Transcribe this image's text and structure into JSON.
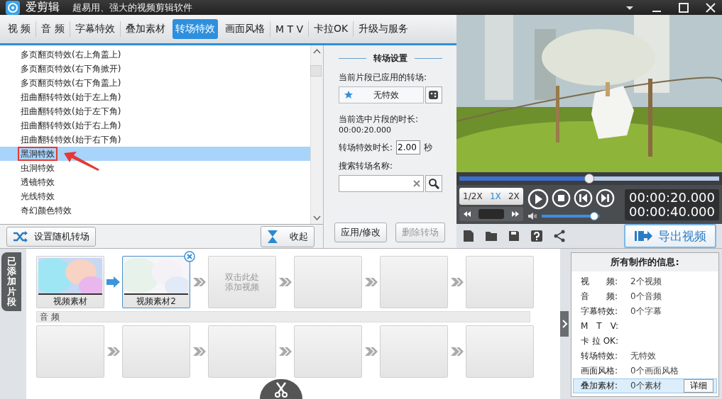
{
  "app": {
    "name": "爱剪辑",
    "tagline": "超易用、强大的视频剪辑软件"
  },
  "tabs": [
    {
      "label": "视 频",
      "selected": false
    },
    {
      "label": "音 频",
      "selected": false
    },
    {
      "label": "字幕特效",
      "selected": false
    },
    {
      "label": "叠加素材",
      "selected": false
    },
    {
      "label": "转场特效",
      "selected": true
    },
    {
      "label": "画面风格",
      "selected": false
    },
    {
      "label": "M T V",
      "selected": false
    },
    {
      "label": "卡拉OK",
      "selected": false
    },
    {
      "label": "升级与服务",
      "selected": false
    }
  ],
  "effects": [
    {
      "label": "多页翻页特效(右上角盖上)",
      "selected": false,
      "annotated": false
    },
    {
      "label": "多页翻页特效(右下角掀开)",
      "selected": false,
      "annotated": false
    },
    {
      "label": "多页翻页特效(右下角盖上)",
      "selected": false,
      "annotated": false
    },
    {
      "label": "扭曲翻转特效(始于左上角)",
      "selected": false,
      "annotated": false
    },
    {
      "label": "扭曲翻转特效(始于左下角)",
      "selected": false,
      "annotated": false
    },
    {
      "label": "扭曲翻转特效(始于右上角)",
      "selected": false,
      "annotated": false
    },
    {
      "label": "扭曲翻转特效(始于右下角)",
      "selected": false,
      "annotated": false
    },
    {
      "label": "黑洞特效",
      "selected": true,
      "annotated": true
    },
    {
      "label": "虫洞特效",
      "selected": false,
      "annotated": false
    },
    {
      "label": "透镜特效",
      "selected": false,
      "annotated": false
    },
    {
      "label": "光线特效",
      "selected": false,
      "annotated": false
    },
    {
      "label": "奇幻颜色特效",
      "selected": false,
      "annotated": false
    }
  ],
  "list_buttons": {
    "random": "设置随机转场",
    "collapse": "收起"
  },
  "settings": {
    "title": "转场设置",
    "applied_label": "当前片段已应用的转场:",
    "applied_value": "无特效",
    "clip_length_label": "当前选中片段的时长:",
    "clip_length_value": "00:00:20.000",
    "effect_length_label": "转场特效时长:",
    "effect_length_value": "2.00",
    "unit": "秒",
    "search_label": "搜索转场名称:",
    "apply_button": {
      "label": "应用/修改",
      "disabled": false
    },
    "delete_button": {
      "label": "删除转场",
      "disabled": true
    }
  },
  "player": {
    "progress": {
      "level": 0.5
    },
    "speeds": [
      {
        "label": "1/2X",
        "selected": false
      },
      {
        "label": "1X",
        "selected": true
      },
      {
        "label": "2X",
        "selected": false
      }
    ],
    "time_current": "00:00:20.000",
    "time_total": "00:00:40.000",
    "volume": {
      "level": 0.97
    },
    "export_button": "导出视频"
  },
  "timeline": {
    "side_tab": "已添加片段",
    "video": [
      {
        "kind": "clip",
        "label": "视频素材",
        "selected": false
      },
      {
        "kind": "clip",
        "label": "视频素材2",
        "selected": true
      },
      {
        "kind": "hint",
        "label": "双击此处添加视频"
      },
      {
        "kind": "empty"
      },
      {
        "kind": "empty"
      },
      {
        "kind": "empty"
      }
    ],
    "audio_label": "音 频",
    "audio": [
      {
        "kind": "empty"
      },
      {
        "kind": "empty"
      },
      {
        "kind": "empty"
      },
      {
        "kind": "empty"
      },
      {
        "kind": "empty"
      },
      {
        "kind": "empty"
      }
    ]
  },
  "info": {
    "title": "所有制作的信息:",
    "rows": [
      {
        "label": "视　　频:",
        "value": "2个视频",
        "highlighted": false
      },
      {
        "label": "音　　频:",
        "value": "0个音频",
        "highlighted": false
      },
      {
        "label": "字幕特效:",
        "value": "0个字幕",
        "highlighted": false
      },
      {
        "label": "M　T　V:",
        "highlighted": false
      },
      {
        "label": "卡 拉 OK:",
        "highlighted": false
      },
      {
        "label": "转场特效:",
        "value": "无特效",
        "highlighted": false
      },
      {
        "label": "画面风格:",
        "value": "0个画面风格",
        "highlighted": false
      },
      {
        "label": "叠加素材:",
        "value": "0个素材",
        "highlighted": true,
        "button": "详细"
      }
    ]
  }
}
